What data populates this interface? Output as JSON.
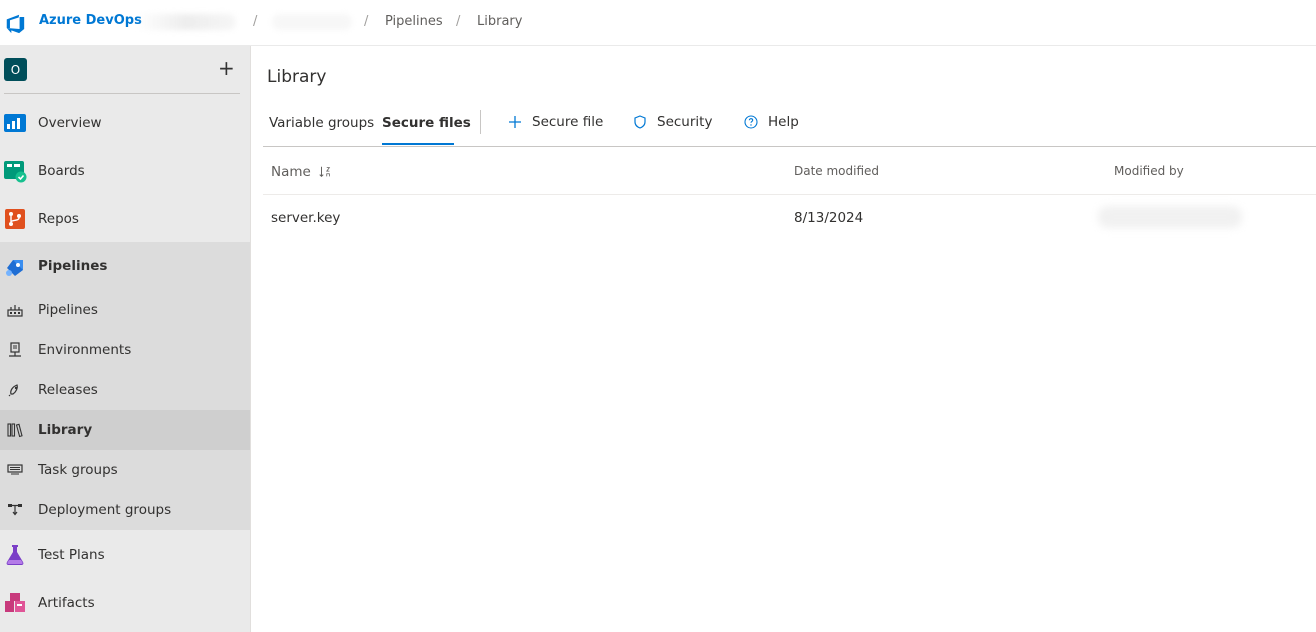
{
  "header": {
    "brand": "Azure DevOps",
    "breadcrumbs": [
      "Pipelines",
      "Library"
    ],
    "separator": "/"
  },
  "sidebar": {
    "project_avatar": "O",
    "add_label": "+",
    "items": [
      {
        "label": "Overview",
        "icon": "overview-icon"
      },
      {
        "label": "Boards",
        "icon": "boards-icon"
      },
      {
        "label": "Repos",
        "icon": "repos-icon"
      },
      {
        "label": "Pipelines",
        "icon": "pipelines-icon"
      },
      {
        "label": "Test Plans",
        "icon": "test-plans-icon"
      },
      {
        "label": "Artifacts",
        "icon": "artifacts-icon"
      }
    ],
    "pipeline_subitems": [
      {
        "label": "Pipelines",
        "icon": "pipelines-sub-icon"
      },
      {
        "label": "Environments",
        "icon": "environments-icon"
      },
      {
        "label": "Releases",
        "icon": "releases-icon"
      },
      {
        "label": "Library",
        "icon": "library-icon",
        "selected": true
      },
      {
        "label": "Task groups",
        "icon": "task-groups-icon"
      },
      {
        "label": "Deployment groups",
        "icon": "deployment-groups-icon"
      }
    ]
  },
  "main": {
    "title": "Library",
    "tabs": [
      {
        "label": "Variable groups",
        "active": false
      },
      {
        "label": "Secure files",
        "active": true
      }
    ],
    "commands": [
      {
        "label": "Secure file",
        "icon": "plus-icon"
      },
      {
        "label": "Security",
        "icon": "shield-icon"
      },
      {
        "label": "Help",
        "icon": "help-icon"
      }
    ],
    "table": {
      "columns": [
        "Name",
        "Date modified",
        "Modified by"
      ],
      "rows": [
        {
          "name": "server.key",
          "date_modified": "8/13/2024",
          "modified_by": ""
        }
      ]
    }
  },
  "colors": {
    "accent": "#0078d4",
    "sidebar_bg": "#eaeaea",
    "project_avatar_bg": "#004e5a"
  }
}
